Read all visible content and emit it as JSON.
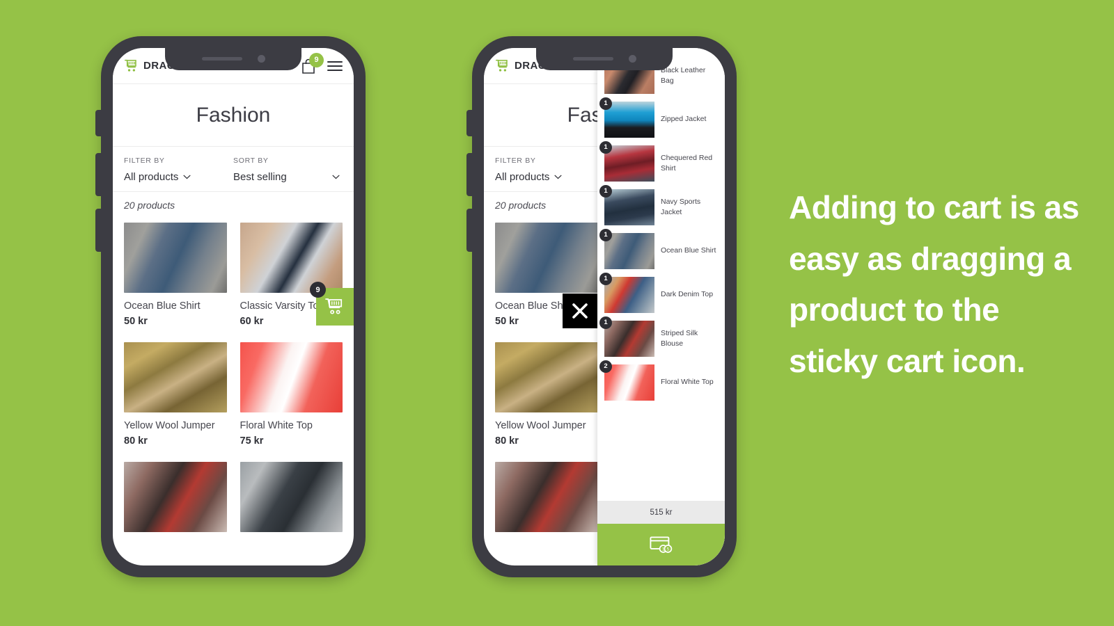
{
  "background_color": "#95c247",
  "brand_color": "#95c247",
  "badge_color": "#2d2d33",
  "headline": "Adding to cart is as easy as dragging a product to the sticky cart icon.",
  "store": {
    "logo_text": "DRAG",
    "logo_icon": "cart-icon",
    "header": {
      "bag_icon": "shopping-bag-icon",
      "bag_count": "9",
      "menu_icon": "hamburger-menu-icon"
    },
    "page_title": "Fashion",
    "filter": {
      "label": "FILTER BY",
      "value": "All products",
      "chevron_icon": "chevron-down-icon"
    },
    "sort": {
      "label": "SORT BY",
      "value": "Best selling",
      "chevron_icon": "chevron-down-icon"
    },
    "product_count": "20 products",
    "products": [
      {
        "name": "Ocean Blue Shirt",
        "price": "50 kr",
        "photo": "ph-ocean"
      },
      {
        "name": "Classic Varsity Top",
        "price": "60 kr",
        "photo": "ph-varsity"
      },
      {
        "name": "Yellow Wool Jumper",
        "price": "80 kr",
        "photo": "ph-yellow"
      },
      {
        "name": "Floral White Top",
        "price": "75 kr",
        "photo": "ph-floral"
      },
      {
        "name": "",
        "price": "",
        "photo": "ph-striped"
      },
      {
        "name": "",
        "price": "",
        "photo": "ph-leather"
      }
    ],
    "sticky_cart": {
      "icon": "shopping-cart-icon",
      "count": "9"
    }
  },
  "cart_drawer": {
    "close_icon": "close-x-icon",
    "items": [
      {
        "qty": "",
        "name": "Black Leather Bag",
        "photo": "ph-bag"
      },
      {
        "qty": "1",
        "name": "Zipped Jacket",
        "photo": "ph-zipped"
      },
      {
        "qty": "1",
        "name": "Chequered Red Shirt",
        "photo": "ph-chequered"
      },
      {
        "qty": "1",
        "name": "Navy Sports Jacket",
        "photo": "ph-navy"
      },
      {
        "qty": "1",
        "name": "Ocean Blue Shirt",
        "photo": "ph-ocean"
      },
      {
        "qty": "1",
        "name": "Dark Denim Top",
        "photo": "ph-denim"
      },
      {
        "qty": "1",
        "name": "Striped Silk Blouse",
        "photo": "ph-striped"
      },
      {
        "qty": "2",
        "name": "Floral White Top",
        "photo": "ph-floral"
      }
    ],
    "total": "515 kr",
    "checkout_icon": "payment-card-icon"
  }
}
